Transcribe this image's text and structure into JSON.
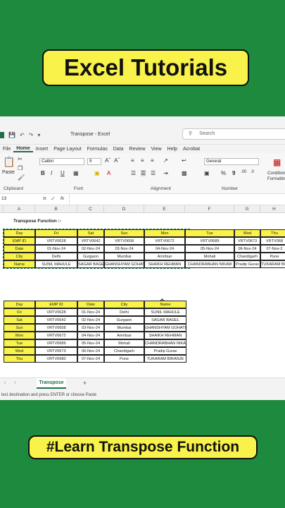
{
  "banners": {
    "top": "Excel Tutorials",
    "bottom": "#Learn Transpose Function"
  },
  "window": {
    "title": "Transpose - Excel",
    "search_placeholder": "Search"
  },
  "menu": [
    "File",
    "Home",
    "Insert",
    "Page Layout",
    "Formulas",
    "Data",
    "Review",
    "View",
    "Help",
    "Acrobat"
  ],
  "ribbon": {
    "paste": "Paste",
    "font_name": "Calibri",
    "font_size": "9",
    "number_format": "General",
    "groups": [
      "Clipboard",
      "Font",
      "Alignment",
      "Number"
    ],
    "cond_format": "Conditional Formatting"
  },
  "formula_bar": {
    "name_box": "13",
    "fx": "fx"
  },
  "columns": [
    "A",
    "B",
    "C",
    "D",
    "E",
    "F",
    "G",
    "H"
  ],
  "heading": "Transpose Function :-",
  "transposed": [
    [
      "Day",
      "Fri",
      "Sat",
      "Sun",
      "Mon",
      "Tue",
      "Wed",
      "Thu"
    ],
    [
      "EMP ID",
      "VRTV0628",
      "VRTV0642",
      "VRTV0658",
      "VRTV0672",
      "VRTV0689",
      "VRTV0673",
      "VRTV068"
    ],
    [
      "Date",
      "01-Nov-24",
      "02-Nov-24",
      "03-Nov-24",
      "04-Nov-24",
      "05-Nov-24",
      "06-Nov-24",
      "07-Nov-2"
    ],
    [
      "City",
      "Delhi",
      "Gurgaon",
      "Mumbai",
      "Amritsar",
      "Mohali",
      "Chandigarh",
      "Pune"
    ],
    [
      "Name",
      "SUNIL MAHULE",
      "SAGAR BAGEL",
      "GHANSHYAM GOHATE",
      "SHAIKH REHMAN",
      "CHANDRABHAN NIKAM",
      "Pradip Gurav",
      "TUKARAM BIR"
    ]
  ],
  "source": [
    [
      "Day",
      "EMP ID",
      "Date",
      "City",
      "Name"
    ],
    [
      "Fri",
      "VRTV0628",
      "01-Nov-24",
      "Delhi",
      "SUNIL MAHULE"
    ],
    [
      "Sat",
      "VRTV0642",
      "02-Nov-24",
      "Gurgaon",
      "SAGAR BAGEL"
    ],
    [
      "Sun",
      "VRTV0658",
      "03-Nov-24",
      "Mumbai",
      "GHANSHYAM GOHATE"
    ],
    [
      "Mon",
      "VRTV0672",
      "04-Nov-24",
      "Amritsar",
      "SHAIKH REHMAN"
    ],
    [
      "Tue",
      "VRTV0689",
      "05-Nov-24",
      "Mohali",
      "CHANDRABHAN NIKAM"
    ],
    [
      "Wed",
      "VRTV0673",
      "06-Nov-24",
      "Chandigarh",
      "Pradip Gurav"
    ],
    [
      "Thu",
      "VRTV0680",
      "07-Nov-24",
      "Pune",
      "TUKARAM BIRANJE"
    ]
  ],
  "sheet_tab": "Transpose",
  "add_sheet": "+",
  "status_text": "lect destination and press ENTER or choose Paste"
}
